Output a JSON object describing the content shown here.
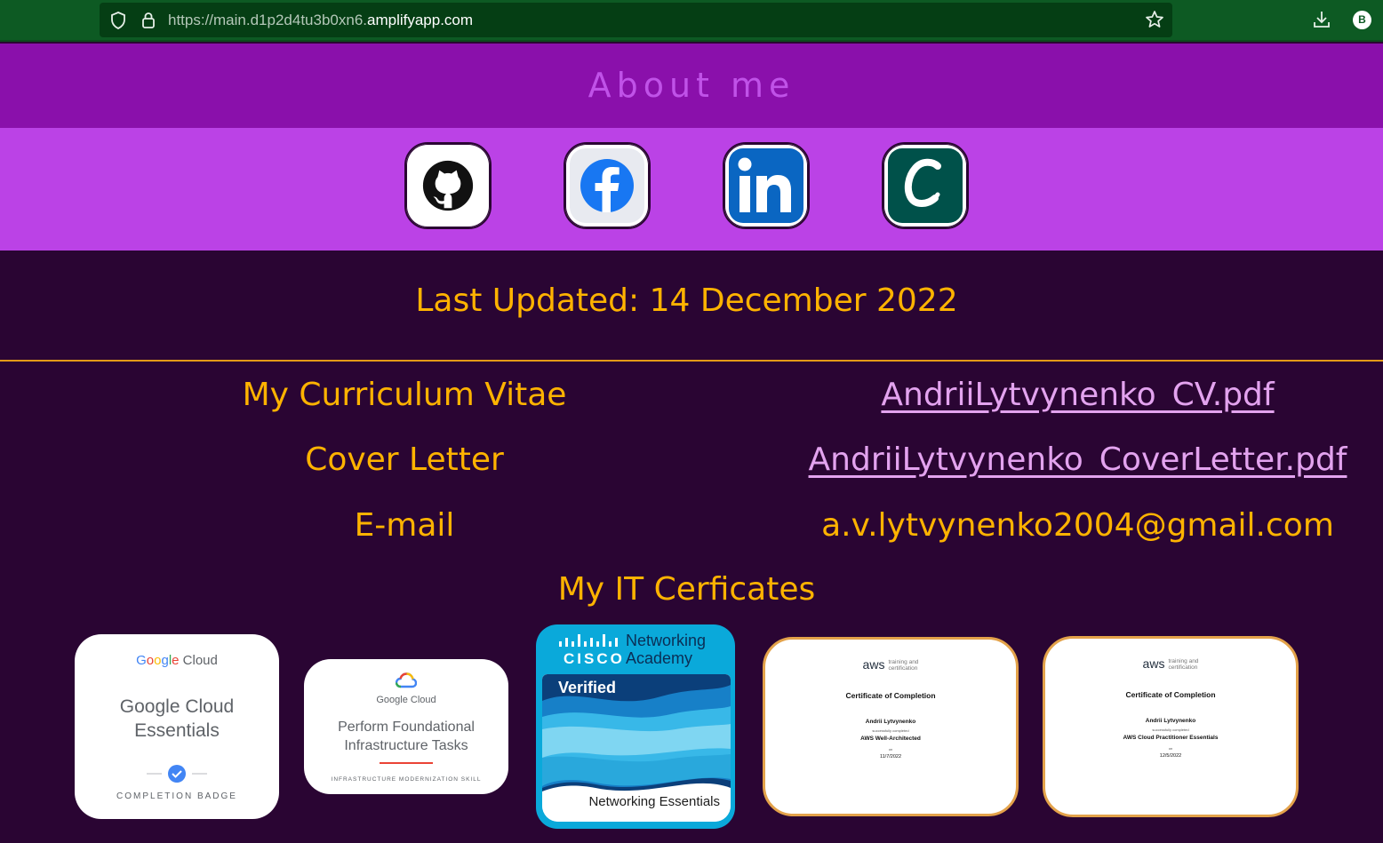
{
  "browser": {
    "url_prefix": "https://main.d1p2d4tu3b0xn6.",
    "url_domain": "amplifyapp.com",
    "profile_initial": "B"
  },
  "header": {
    "title": "About me"
  },
  "social": [
    {
      "name": "github",
      "icon": "github-icon"
    },
    {
      "name": "facebook",
      "icon": "facebook-icon"
    },
    {
      "name": "linkedin",
      "icon": "linkedin-icon"
    },
    {
      "name": "credly",
      "icon": "credly-icon"
    }
  ],
  "updated": "Last Updated: 14 December 2022",
  "rows": {
    "cv_label": "My Curriculum Vitae",
    "cv_link": "AndriiLytvynenko_CV.pdf",
    "cover_label": "Cover Letter",
    "cover_link": "AndriiLytvynenko_CoverLetter.pdf",
    "email_label": "E-mail",
    "email_value": "a.v.lytvynenko2004@gmail.com"
  },
  "certs": {
    "title": "My IT Cerficates",
    "gc1": {
      "logo_cloud": "Cloud",
      "title_line1": "Google Cloud",
      "title_line2": "Essentials",
      "footer": "COMPLETION BADGE"
    },
    "gc2": {
      "logo": "Google Cloud",
      "title_line1": "Perform Foundational",
      "title_line2": "Infrastructure Tasks",
      "footer": "INFRASTRUCTURE MODERNIZATION SKILL"
    },
    "cisco": {
      "brand": "CISCO",
      "line1": "Networking",
      "line2": "Academy",
      "verified": "Verified",
      "course": "Networking Essentials"
    },
    "aws1": {
      "logo": "aws",
      "tc1": "training and",
      "tc2": "certification",
      "heading": "Certificate of Completion",
      "name": "Andrii Lytvynenko",
      "sub": "successfully completed",
      "course": "AWS Well-Architected",
      "on": "on",
      "date": "11/7/2022"
    },
    "aws2": {
      "logo": "aws",
      "tc1": "training and",
      "tc2": "certification",
      "heading": "Certificate of Completion",
      "name": "Andrii Lytvynenko",
      "sub": "successfully completed",
      "course": "AWS Cloud Practitioner Essentials",
      "on": "on",
      "date": "12/5/2022"
    }
  },
  "colors": {
    "header_band": "#8a10ab",
    "social_band": "#bb42e6",
    "page_bg": "#2a0533",
    "accent_text": "#ffb300",
    "link_text": "#e3a3ef"
  }
}
